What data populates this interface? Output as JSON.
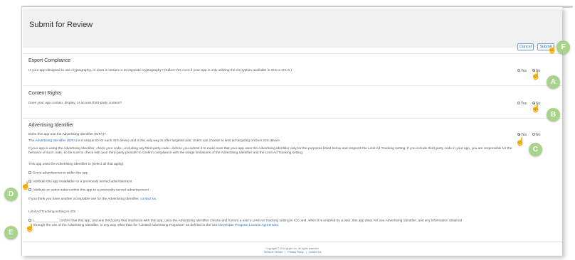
{
  "page_title": "Submit for Review",
  "buttons": {
    "cancel": "Cancel",
    "submit": "Submit"
  },
  "export_compliance": {
    "title": "Export Compliance",
    "question": "Is your app designed to use cryptography, or does it contain or incorporate cryptography? (Select Yes even if your app is only utilizing the encryption available in iOS or OS X.)",
    "yes": "Yes",
    "no": "No",
    "selected": "No"
  },
  "content_rights": {
    "title": "Content Rights",
    "question": "Does your app contain, display, or access third-party content?",
    "yes": "Yes",
    "no": "No",
    "selected": "No"
  },
  "advertising": {
    "title": "Advertising Identifier",
    "question": "Does this app use the Advertising Identifier (IDFA)?",
    "yes": "Yes",
    "no": "No",
    "selected": "Yes",
    "desc_prefix": "The ",
    "desc_link": "Advertising Identifier (IDFA)",
    "desc_suffix": " is a unique ID for each iOS device and is the only way to offer targeted ads. Users can choose to limit ad targeting on their iOS device.",
    "usage_note": "If your app is using the Advertising Identifier, check your code—including any third-party code—before you submit it to make sure that your app uses the Advertising Identifier only for the purposes listed below and respects the Limit Ad Tracking setting. If you include third-party code in your app, you are responsible for the behavior of such code, so be sure to check with your third-party provider to confirm compliance with the usage limitations of the Advertising Identifier and the Limit Ad Tracking setting.",
    "uses_label": "This app uses the Advertising Identifier to (select all that apply):",
    "options": [
      {
        "label": "Serve advertisements within the app",
        "checked": false
      },
      {
        "label": "Attribute this app installation to a previously served advertisement",
        "checked": true
      },
      {
        "label": "Attribute an action taken within this app to a previously served advertisement",
        "checked": false
      }
    ],
    "other_use_text": "If you think you have another acceptable use for the Advertising Identifier, ",
    "contact_link": "contact us",
    "other_use_end": ".",
    "lat_title": "Limit Ad Tracking setting in iOS",
    "lat_confirm_line1": "I, ____________ confirm that this app, and any third party that interfaces with this app, uses the Advertising Identifier checks and honors a user's Limit Ad Tracking setting in iOS and, when it is enabled by a user, this app does not use Advertising Identifier, and any information obtained",
    "lat_confirm_line2": "through the use of the Advertising Identifier, in any way other than for \"Limited Advertising Purposes\" as defined in the ",
    "lat_license_link": "iOS Developer Program License Agreement",
    "lat_end": "."
  },
  "footer": {
    "copyright": "Copyright © 2014 Apple Inc. All rights reserved.",
    "links": [
      "Terms of Service",
      "Privacy Policy",
      "Contact Us"
    ]
  },
  "callouts": [
    "A",
    "B",
    "C",
    "D",
    "E",
    "F"
  ],
  "colors": {
    "callout": "#a7d48a",
    "link": "#2a6ebb",
    "header_bg": "#f1f1f1"
  }
}
